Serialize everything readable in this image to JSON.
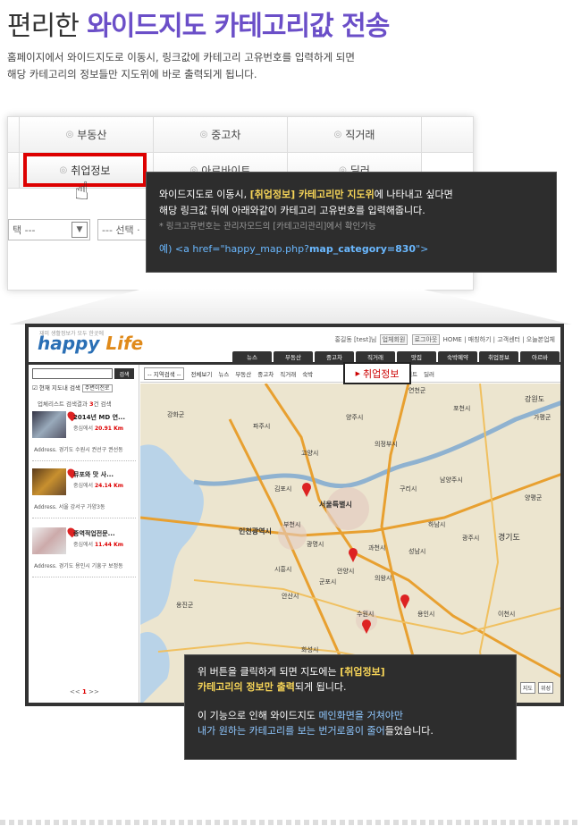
{
  "title": {
    "part1": "편리한",
    "part2": "와이드지도 카테고리값 전송"
  },
  "description": [
    "홈페이지에서 와이드지도로 이동시, 링크값에 카테고리 고유번호를 입력하게 되면",
    "해당 카테고리의 정보들만 지도위에 바로 출력되게 됩니다."
  ],
  "category_table": {
    "row1": [
      "부동산",
      "중고차",
      "직거래"
    ],
    "highlight_label": "취업정보",
    "row2_partial": [
      "아르바이트",
      "딜러"
    ],
    "select1": "택 ---",
    "select2": "--- 선택 ·"
  },
  "tip1": {
    "line1_pre": "와이드지도로 이동시, ",
    "line1_bold": "[취업정보] 카테고리만 지도위",
    "line1_post": "에 나타내고 싶다면",
    "line2": "해당 링크값 뒤에 아래와같이 카테고리 고유번호를 입력해줍니다.",
    "note": "* 링크고유번호는 관리자모드의 [카테고리관리]에서 확인가능",
    "code_pre": "예) <a href=\"happy_map.php?",
    "code_bold": "map_category=830",
    "code_post": "\">"
  },
  "site": {
    "logo_sub": "재미 생활정보가 모두 한곳에",
    "logo_happy": "happy",
    "logo_life": "Life",
    "topnav_user": "홍길동 [test]님",
    "topnav_b1": "업체회원",
    "topnav_b2": "로그아웃",
    "topnav_links": "HOME | 매칭하기 | 고객센터 | 오늘본업체",
    "tabs": [
      "뉴스",
      "부동산",
      "중고차",
      "직거래",
      "맛집",
      "숙박예약",
      "취업정보",
      "아르바"
    ],
    "search_btn": "검색",
    "check_label": "현재 지도내 검색",
    "check_btn": "주변이전로",
    "list_title_pre": "업체리스트 검색결과 ",
    "list_title_n": "3",
    "list_title_post": "건 검색",
    "items": [
      {
        "name": "2014년 MD 연...",
        "dist_pre": "중심에서 ",
        "dist": "20.91 Km",
        "addr": "Address. 경기도 수원시 권선구 권선동"
      },
      {
        "name": "뮤포와 맛 사...",
        "dist_pre": "중심에서 ",
        "dist": "24.14 Km",
        "addr": "Address. 서울 강서구 가양3동"
      },
      {
        "name": "종역적업전문...",
        "dist_pre": "중심에서 ",
        "dist": "11.44 Km",
        "addr": "Address. 경기도 용인시 기흥구 보정동"
      }
    ],
    "pager_prev": "<<",
    "pager_page": "1",
    "pager_next": ">>",
    "mapbar_select": "-- 지역검색 --",
    "mapbar_links": [
      "전체보기",
      "뉴스",
      "부동산",
      "중고차",
      "직거래",
      "숙박"
    ],
    "mapbar_links2": [
      "아르바이트",
      "딜러"
    ],
    "bubble": "취업정보",
    "map_labels": [
      "강화군",
      "김포시",
      "서울특별시",
      "인천광역시",
      "부천시",
      "광명시",
      "안양시",
      "과천시",
      "군포시",
      "의왕시",
      "시흥시",
      "안산시",
      "수원시",
      "용인시",
      "성남시",
      "하남시",
      "구리시",
      "남양주시",
      "의정부시",
      "양주시",
      "고양시",
      "파주시",
      "포천시",
      "가평군",
      "양평군",
      "광주시",
      "이천시",
      "화성시",
      "평택시",
      "옹진군",
      "경기도",
      "강원도",
      "연천군"
    ],
    "map_ctrl": [
      "지도",
      "위성"
    ]
  },
  "tip2": {
    "line1_pre": "위 버튼을 클릭하게 되면 지도에는 ",
    "line1_bold": "[취업정보]",
    "line2_bold": "카테고리의 정보만 출력",
    "line2_post": "되게 됩니다.",
    "line3_pre": "이 기능으로 인해 와이드지도 ",
    "line3_blue": "메인화면을 거쳐야만",
    "line4_blue": "내가 원하는 카테고리를 보는 번거로움이 줄어",
    "line4_post": "들었습니다."
  },
  "colors": {
    "title_accent": "#6b4fc8",
    "highlight_border": "#dd0000",
    "tooltip_bg": "#2d2d2d",
    "tooltip_yellow": "#f7d558",
    "tooltip_blue": "#8fc7ff"
  }
}
